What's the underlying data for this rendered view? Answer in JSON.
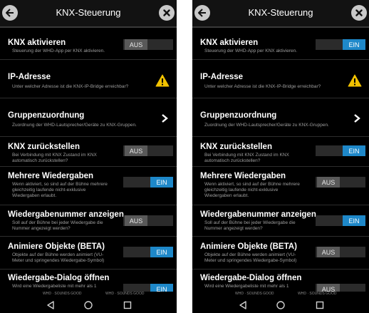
{
  "header": {
    "title": "KNX-Steuerung"
  },
  "items": [
    {
      "title": "KNX aktivieren",
      "subtitle": "Steuerung der WHD-App per KNX aktivieren."
    },
    {
      "title": "IP-Adresse",
      "subtitle": "Unter welcher Adresse ist die KNX-IP-Bridge erreichbar?"
    },
    {
      "title": "Gruppenzuordnung",
      "subtitle": "Zuordnung der WHD-Lautsprecher/Geräte zu KNX-Gruppen."
    },
    {
      "title": "KNX zurückstellen",
      "subtitle": "Bei Verbindung mit KNX Zustand im KNX automatisch zurückstellen?"
    },
    {
      "title": "Mehrere Wiedergaben",
      "subtitle": "Wenn aktiviert, so sind auf der Bühne mehrere gleichzeitig laufende nicht-exklusive Wiedergaben erlaubt."
    },
    {
      "title": "Wiedergabenummer anzeigen",
      "subtitle": "Soll auf der Bühne bei jeder Wiedergabe die Nummer angezeigt werden?"
    },
    {
      "title": "Animiere Objekte (BETA)",
      "subtitle": "Objekte auf der Bühne werden animiert (VU-Meter und springendes Wiedergabe-Symbol)"
    },
    {
      "title": "Wiedergabe-Dialog öffnen",
      "subtitle": "Wird eine Wiedergabeliste mit mehr als 1"
    }
  ],
  "toggle_labels": {
    "on": "EIN",
    "off": "AUS"
  },
  "left_states": [
    "AUS",
    "",
    "",
    "AUS",
    "EIN",
    "AUS",
    "EIN",
    "EIN"
  ],
  "right_states": [
    "EIN",
    "",
    "",
    "EIN",
    "AUS",
    "EIN",
    "AUS",
    "AUS"
  ],
  "footer": {
    "left": "WHD · SOUNDS GOOD",
    "right": "WHD · SOUNDS GOOD"
  },
  "colors": {
    "accent": "#1e88c9",
    "warning": "#f2c200",
    "background": "#000000"
  },
  "icons": {
    "back": "back-arrow-icon",
    "close": "close-icon",
    "warning": "warning-icon",
    "chevron": "chevron-right-icon",
    "nav_back": "nav-back-icon",
    "nav_home": "nav-home-icon",
    "nav_recents": "nav-recents-icon"
  }
}
